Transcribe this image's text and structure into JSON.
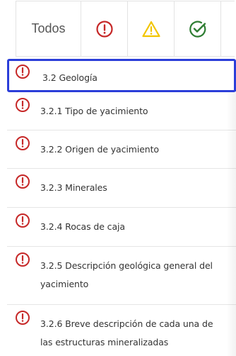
{
  "filters": {
    "all_label": "Todos",
    "error_icon": "exclamation-circle-icon",
    "warning_icon": "warning-triangle-icon",
    "ok_icon": "check-circle-icon",
    "error_color": "#c62828",
    "warning_color": "#f2c500",
    "ok_color": "#2e7d32"
  },
  "items": [
    {
      "label": "3.2 Geología",
      "status": "error",
      "selected": true
    },
    {
      "label": "3.2.1 Tipo de yacimiento",
      "status": "error"
    },
    {
      "label": "3.2.2 Origen de yacimiento",
      "status": "error"
    },
    {
      "label": "3.2.3 Minerales",
      "status": "error"
    },
    {
      "label": "3.2.4 Rocas de caja",
      "status": "error"
    },
    {
      "label": "3.2.5 Descripción geológica general del yacimiento",
      "status": "error"
    },
    {
      "label": "3.2.6 Breve descripción de cada una de las estructuras mineralizadas",
      "status": "error"
    }
  ],
  "selection_color": "#2b3ed9"
}
